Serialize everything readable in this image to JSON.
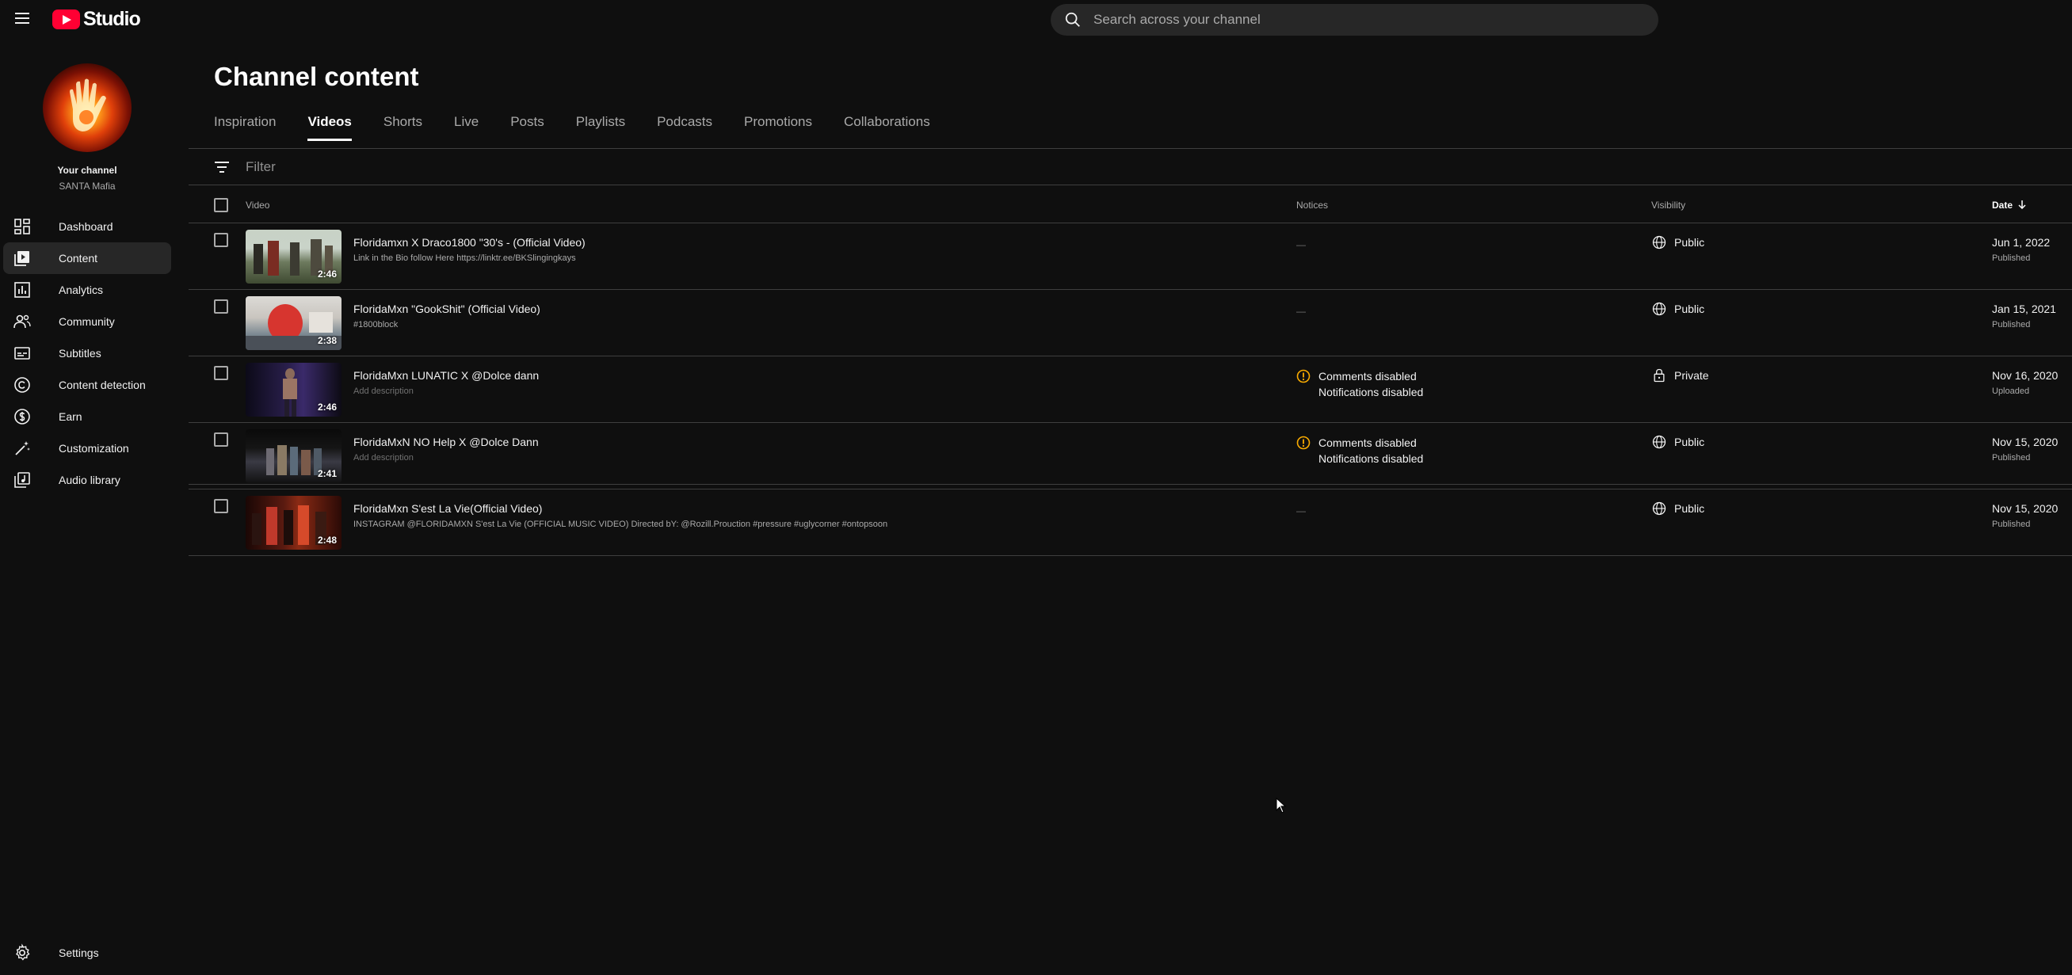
{
  "app": {
    "logo_text": "Studio"
  },
  "search": {
    "placeholder": "Search across your channel"
  },
  "channel": {
    "your_channel_label": "Your channel",
    "name": "SANTA Mafia"
  },
  "sidebar": {
    "items": [
      {
        "label": "Dashboard",
        "icon": "dashboard-icon"
      },
      {
        "label": "Content",
        "icon": "content-icon",
        "active": true
      },
      {
        "label": "Analytics",
        "icon": "analytics-icon"
      },
      {
        "label": "Community",
        "icon": "community-icon"
      },
      {
        "label": "Subtitles",
        "icon": "subtitles-icon"
      },
      {
        "label": "Content detection",
        "icon": "copyright-icon"
      },
      {
        "label": "Earn",
        "icon": "dollar-icon"
      },
      {
        "label": "Customization",
        "icon": "magic-wand-icon"
      },
      {
        "label": "Audio library",
        "icon": "audio-library-icon"
      }
    ],
    "settings_label": "Settings"
  },
  "page": {
    "title": "Channel content"
  },
  "tabs": [
    {
      "label": "Inspiration"
    },
    {
      "label": "Videos",
      "active": true
    },
    {
      "label": "Shorts"
    },
    {
      "label": "Live"
    },
    {
      "label": "Posts"
    },
    {
      "label": "Playlists"
    },
    {
      "label": "Podcasts"
    },
    {
      "label": "Promotions"
    },
    {
      "label": "Collaborations"
    }
  ],
  "filter": {
    "placeholder": "Filter"
  },
  "table": {
    "headers": {
      "video": "Video",
      "notices": "Notices",
      "visibility": "Visibility",
      "date": "Date"
    },
    "rows": [
      {
        "title": "Floridamxn X Draco1800 \"30's - (Official Video)",
        "description": "Link in the Bio follow Here https://linktr.ee/BKSlingingkays",
        "duration": "2:46",
        "notice": "—",
        "visibility": "Public",
        "date": "Jun 1, 2022",
        "status": "Published"
      },
      {
        "title": "FloridaMxn \"GookShit\" (Official Video)",
        "description": "#1800block",
        "duration": "2:38",
        "notice": "—",
        "visibility": "Public",
        "date": "Jan 15, 2021",
        "status": "Published"
      },
      {
        "title": "FloridaMxn LUNATIC X @Dolce dann",
        "description": "Add description",
        "duration": "2:46",
        "notice_line1": "Comments disabled",
        "notice_line2": "Notifications disabled",
        "visibility": "Private",
        "date": "Nov 16, 2020",
        "status": "Uploaded"
      },
      {
        "title": "FloridaMxN NO Help X @Dolce Dann",
        "description": "Add description",
        "duration": "2:41",
        "notice_line1": "Comments disabled",
        "notice_line2": "Notifications disabled",
        "visibility": "Public",
        "date": "Nov 15, 2020",
        "status": "Published"
      },
      {
        "title": "FloridaMxn S'est La Vie(Official Video)",
        "description": "INSTAGRAM @FLORIDAMXN S'est La Vie (OFFICIAL MUSIC VIDEO) Directed bY: @Rozill.Prouction #pressure #uglycorner #ontopsoon",
        "duration": "2:48",
        "notice": "—",
        "visibility": "Public",
        "date": "Nov 15, 2020",
        "status": "Published"
      }
    ]
  },
  "colors": {
    "background": "#0f0f0f",
    "accent": "#ff0033",
    "warning": "#f9ab00"
  }
}
